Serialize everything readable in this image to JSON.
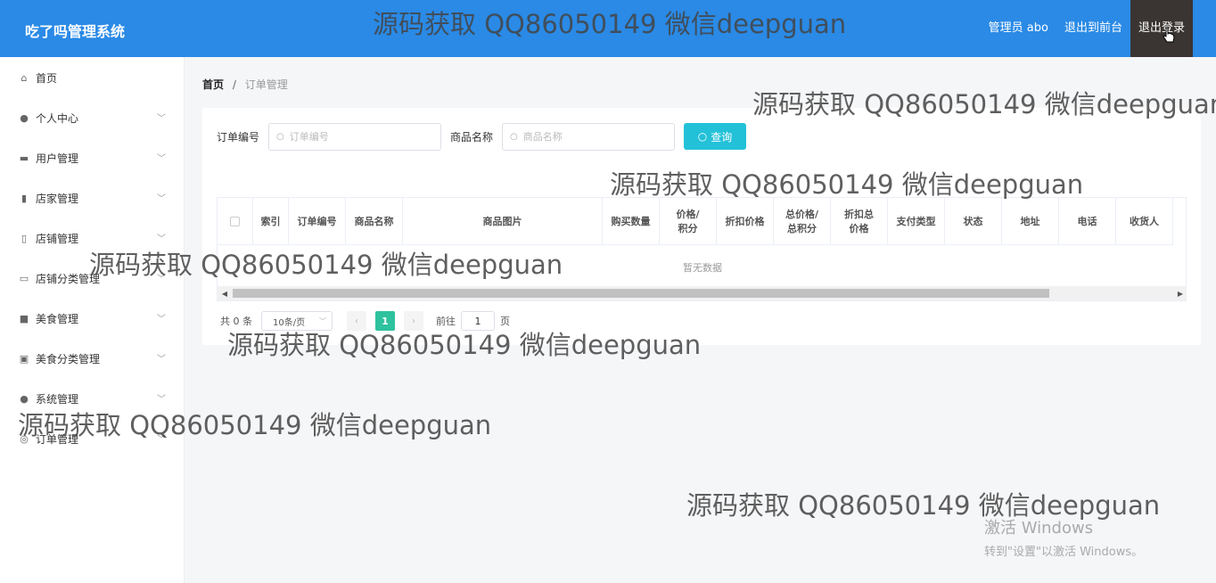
{
  "app": {
    "title": "吃了吗管理系统"
  },
  "topbar": {
    "user": "管理员 abo",
    "front": "退出到前台",
    "logout": "退出登录"
  },
  "sidebar": {
    "items": [
      {
        "label": "首页",
        "icon": "home-icon",
        "glyph": "⌂",
        "expandable": false
      },
      {
        "label": "个人中心",
        "icon": "user-icon",
        "glyph": "●",
        "expandable": true
      },
      {
        "label": "用户管理",
        "icon": "user-manage-icon",
        "glyph": "▬",
        "expandable": true
      },
      {
        "label": "店家管理",
        "icon": "bar-chart-icon",
        "glyph": "▮",
        "expandable": true
      },
      {
        "label": "店铺管理",
        "icon": "shop-icon",
        "glyph": "▯",
        "expandable": true
      },
      {
        "label": "店铺分类管理",
        "icon": "chat-icon",
        "glyph": "▭",
        "expandable": true
      },
      {
        "label": "美食管理",
        "icon": "briefcase-icon",
        "glyph": "■",
        "expandable": true
      },
      {
        "label": "美食分类管理",
        "icon": "card-icon",
        "glyph": "▣",
        "expandable": true
      },
      {
        "label": "系统管理",
        "icon": "person-icon",
        "glyph": "●",
        "expandable": true
      },
      {
        "label": "订单管理",
        "icon": "target-icon",
        "glyph": "◎",
        "expandable": true
      }
    ]
  },
  "breadcrumb": {
    "home": "首页",
    "sep": "/",
    "current": "订单管理"
  },
  "search": {
    "order_label": "订单编号",
    "order_placeholder": "订单编号",
    "goods_label": "商品名称",
    "goods_placeholder": "商品名称",
    "query_label": "查询"
  },
  "table": {
    "columns": [
      "索引",
      "订单编号",
      "商品名称",
      "商品图片",
      "购买数量",
      "价格/积分",
      "折扣价格",
      "总价格/总积分",
      "折扣总价格",
      "支付类型",
      "状态",
      "地址",
      "电话",
      "收货人"
    ],
    "empty_text": "暂无数据"
  },
  "pagination": {
    "total": "共 0 条",
    "page_size": "10条/页",
    "current_page": "1",
    "goto_prefix": "前往",
    "goto_value": "1",
    "goto_suffix": "页"
  },
  "watermark_text": "源码获取 QQ86050149 微信deepguan",
  "activation": {
    "title": "激活 Windows",
    "subtitle": "转到\"设置\"以激活 Windows。"
  }
}
